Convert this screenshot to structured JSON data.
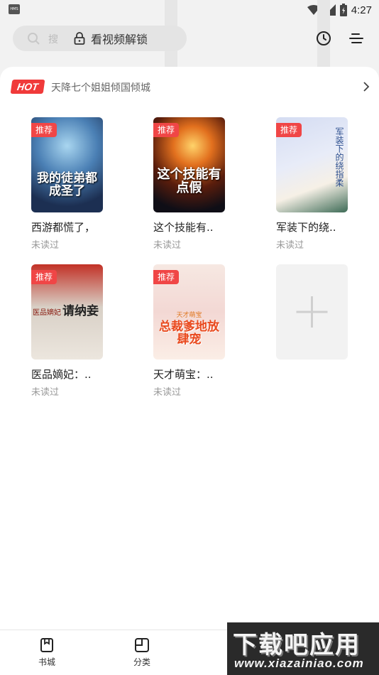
{
  "status_bar": {
    "time": "4:27",
    "notification_icon_label": "HMS"
  },
  "header": {
    "search_placeholder": "搜",
    "unlock_label": "看视频解锁"
  },
  "hot": {
    "badge": "HOT",
    "text": "天降七个姐姐倾国倾城"
  },
  "books": [
    {
      "title": "西游都慌了，",
      "status": "未读过",
      "tag": "推荐",
      "cover_text": "我的徒弟都成圣了"
    },
    {
      "title": "这个技能有..",
      "status": "未读过",
      "tag": "推荐",
      "cover_text": "这个技能有点假"
    },
    {
      "title": "军装下的绕..",
      "status": "未读过",
      "tag": "推荐",
      "cover_text": "军装下的绕指柔"
    },
    {
      "title": "医品嫡妃：..",
      "status": "未读过",
      "tag": "推荐",
      "cover_text": "请纳妾",
      "cover_subtitle": "医品嫡妃"
    },
    {
      "title": "天才萌宝：..",
      "status": "未读过",
      "tag": "推荐",
      "cover_text": "总裁爹地放肆宠",
      "cover_subtitle": "天才萌宝"
    }
  ],
  "bottom_nav": [
    {
      "label": "书城"
    },
    {
      "label": "分类"
    }
  ],
  "watermark": {
    "title": "下载吧应用",
    "url": "www.xiazainiao.com"
  },
  "colors": {
    "accent": "#f03a3a",
    "tag": "#f04646",
    "muted": "#999999"
  }
}
